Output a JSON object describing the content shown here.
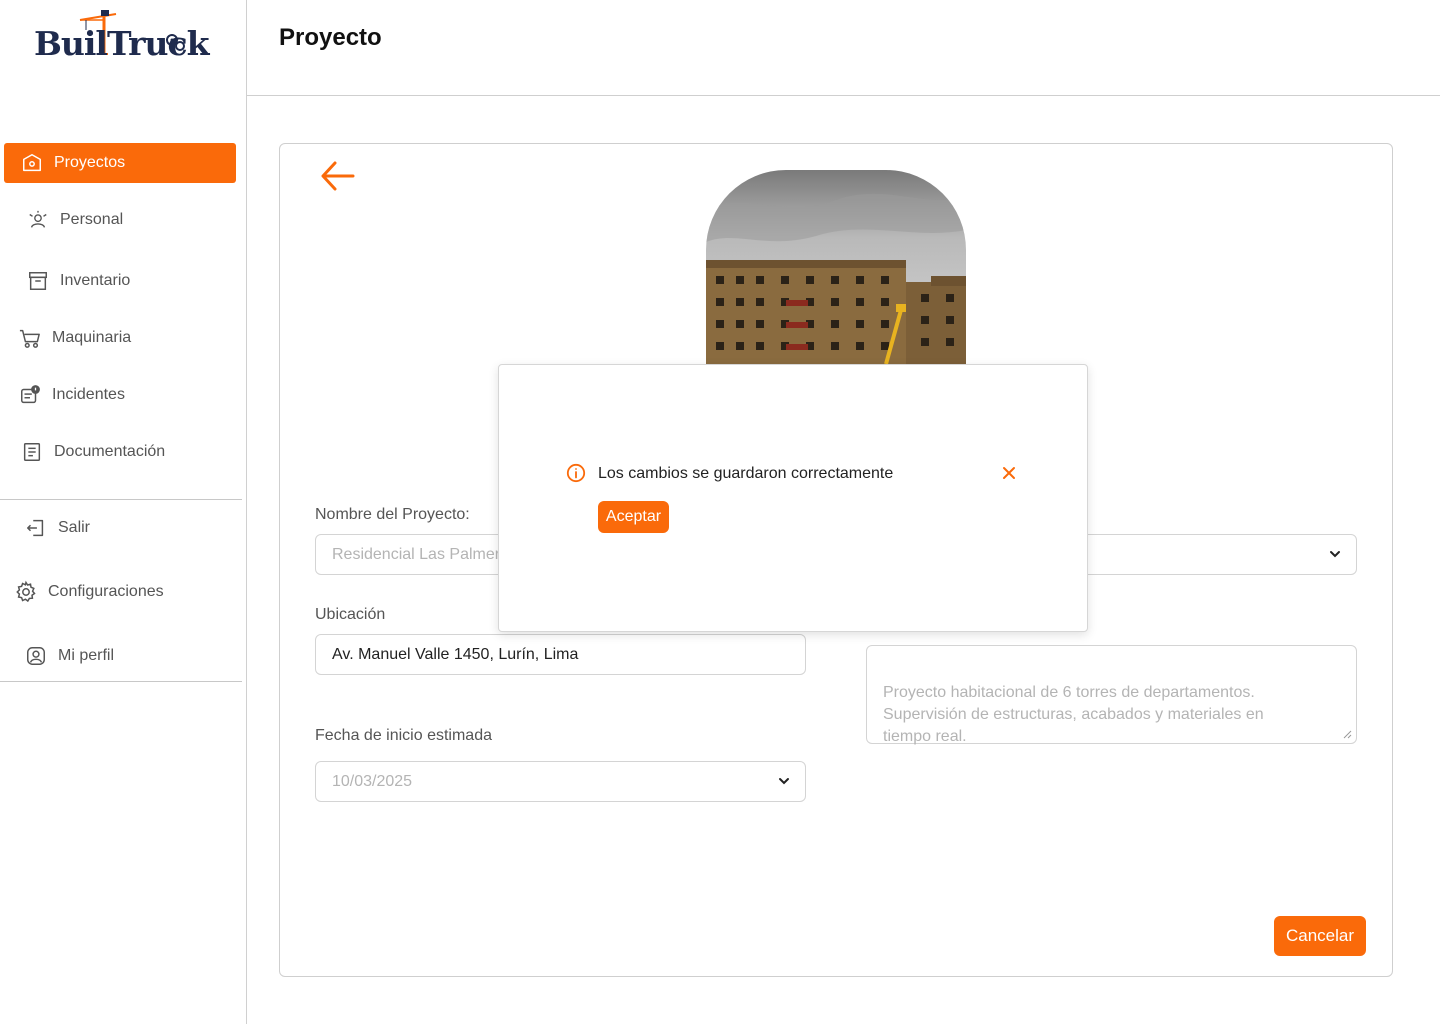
{
  "app": {
    "logo_text": "BuilTruck",
    "page_title": "Proyecto"
  },
  "sidebar": {
    "items": [
      {
        "label": "Proyectos",
        "icon": "home-icon",
        "active": true
      },
      {
        "label": "Personal",
        "icon": "personnel-icon",
        "active": false
      },
      {
        "label": "Inventario",
        "icon": "archive-icon",
        "active": false
      },
      {
        "label": "Maquinaria",
        "icon": "cart-icon",
        "active": false
      },
      {
        "label": "Incidentes",
        "icon": "incident-icon",
        "active": false
      },
      {
        "label": "Documentación",
        "icon": "document-icon",
        "active": false
      }
    ],
    "bottom_items": [
      {
        "label": "Salir",
        "icon": "logout-icon"
      },
      {
        "label": "Configuraciones",
        "icon": "gear-icon"
      },
      {
        "label": "Mi perfil",
        "icon": "user-icon"
      }
    ]
  },
  "form": {
    "project_name_label": "Nombre del Proyecto:",
    "project_name_placeholder": "Residencial Las Palmeras",
    "location_label": "Ubicación",
    "location_value": "Av. Manuel Valle 1450, Lurín, Lima",
    "start_date_label": "Fecha de inicio estimada",
    "start_date_value": "10/03/2025",
    "description_placeholder": "Proyecto habitacional de 6 torres de departamentos.\nSupervisión de estructuras, acabados y materiales en\ntiempo real.",
    "cancel_label": "Cancelar"
  },
  "modal": {
    "message": "Los cambios se guardaron correctamente",
    "accept_label": "Aceptar"
  },
  "colors": {
    "accent": "#fa6a0a",
    "logo_navy": "#1f2b4d"
  }
}
